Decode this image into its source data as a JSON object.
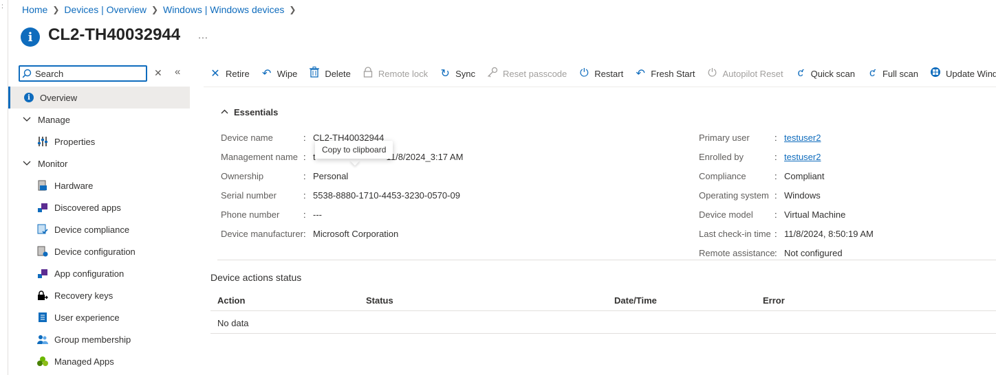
{
  "breadcrumb": {
    "items": [
      "Home",
      "Devices | Overview",
      "Windows | Windows devices"
    ],
    "separator": ">"
  },
  "header": {
    "title": "CL2-TH40032944",
    "more": "..."
  },
  "sidebar": {
    "search_placeholder": "Search",
    "items": [
      {
        "label": "Overview",
        "icon": "info-icon",
        "active": true
      },
      {
        "label": "Manage",
        "icon": "chevron-down-icon"
      },
      {
        "label": "Properties",
        "icon": "properties-icon"
      },
      {
        "label": "Monitor",
        "icon": "chevron-down-icon"
      },
      {
        "label": "Hardware",
        "icon": "hardware-icon"
      },
      {
        "label": "Discovered apps",
        "icon": "discovered-apps-icon"
      },
      {
        "label": "Device compliance",
        "icon": "device-compliance-icon"
      },
      {
        "label": "Device configuration",
        "icon": "device-configuration-icon"
      },
      {
        "label": "App configuration",
        "icon": "app-configuration-icon"
      },
      {
        "label": "Recovery keys",
        "icon": "lock-key-icon"
      },
      {
        "label": "User experience",
        "icon": "user-experience-icon"
      },
      {
        "label": "Group membership",
        "icon": "group-icon"
      },
      {
        "label": "Managed Apps",
        "icon": "managed-apps-icon"
      }
    ]
  },
  "toolbar": {
    "retire": "Retire",
    "wipe": "Wipe",
    "delete": "Delete",
    "remote_lock": "Remote lock",
    "sync": "Sync",
    "reset_passcode": "Reset passcode",
    "restart": "Restart",
    "fresh_start": "Fresh Start",
    "autopilot_reset": "Autopilot Reset",
    "quick_scan": "Quick scan",
    "full_scan": "Full scan",
    "update_windows": "Update Windows"
  },
  "essentials": {
    "header": "Essentials",
    "left": [
      {
        "label": "Device name",
        "value": "CL2-TH40032944"
      },
      {
        "label": "Management name",
        "value": "t",
        "value_tail": "11/8/2024_3:17 AM"
      },
      {
        "label": "Ownership",
        "value": "Personal"
      },
      {
        "label": "Serial number",
        "value": "5538-8880-1710-4453-3230-0570-09"
      },
      {
        "label": "Phone number",
        "value": "---"
      },
      {
        "label": "Device manufacturer",
        "value": "Microsoft Corporation"
      }
    ],
    "right": [
      {
        "label": "Primary user",
        "value": "testuser2"
      },
      {
        "label": "Enrolled by",
        "value": "testuser2"
      },
      {
        "label": "Compliance",
        "value": "Compliant"
      },
      {
        "label": "Operating system",
        "value": "Windows"
      },
      {
        "label": "Device model",
        "value": "Virtual Machine"
      },
      {
        "label": "Last check-in time",
        "value": "11/8/2024, 8:50:19 AM"
      },
      {
        "label": "Remote assistance",
        "value": "Not configured"
      }
    ],
    "separator": ":"
  },
  "tooltip": {
    "text": "Copy to clipboard"
  },
  "actions_status": {
    "title": "Device actions status",
    "columns": [
      "Action",
      "Status",
      "Date/Time",
      "Error"
    ],
    "empty_text": "No data"
  },
  "colors": {
    "accent": "#0f6cbd",
    "active_bg": "#edebe9",
    "disabled_text": "#a19f9d"
  }
}
